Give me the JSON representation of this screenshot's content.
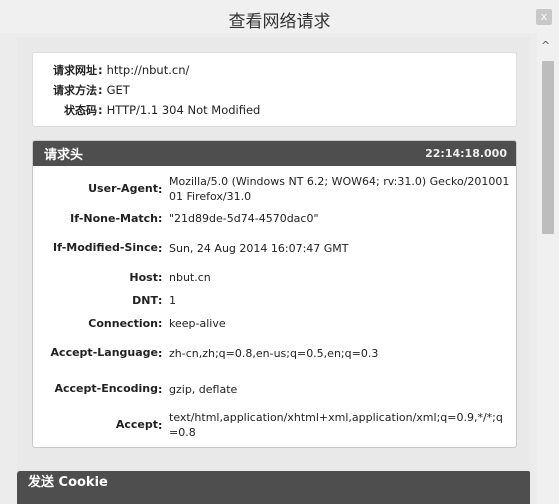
{
  "window": {
    "title": "查看网络请求",
    "close_label": "x"
  },
  "summary": {
    "rows": [
      {
        "label": "请求网址",
        "sep": ":",
        "value": "http://nbut.cn/"
      },
      {
        "label": "请求方法",
        "sep": ":",
        "value": "GET"
      },
      {
        "label": "状态码",
        "sep": ":",
        "value": "HTTP/1.1 304 Not Modified"
      }
    ]
  },
  "request_headers": {
    "title": "请求头",
    "time": "22:14:18.000",
    "rows": [
      {
        "name": "User-Agent",
        "sep": ":",
        "value": "Mozilla/5.0 (Windows NT 6.2; WOW64; rv:31.0) Gecko/20100101 Firefox/31.0"
      },
      {
        "name": "If-None-Match",
        "sep": ":",
        "value": "\"21d89de-5d74-4570dac0\""
      },
      {
        "name": "If-Modified-Since",
        "sep": ":",
        "value": "Sun, 24 Aug 2014 16:07:47 GMT"
      },
      {
        "name": "Host",
        "sep": ":",
        "value": "nbut.cn"
      },
      {
        "name": "DNT",
        "sep": ":",
        "value": "1"
      },
      {
        "name": "Connection",
        "sep": ":",
        "value": "keep-alive"
      },
      {
        "name": "Accept-Language",
        "sep": ":",
        "value": "zh-cn,zh;q=0.8,en-us;q=0.5,en;q=0.3"
      },
      {
        "name": "Accept-Encoding",
        "sep": ":",
        "value": "gzip, deflate"
      },
      {
        "name": "Accept",
        "sep": ":",
        "value": "text/html,application/xhtml+xml,application/xml;q=0.9,*/*;q=0.8"
      }
    ]
  },
  "cookie_section": {
    "title": "发送 Cookie"
  },
  "scrollbar": {
    "up_arrow": "^"
  }
}
